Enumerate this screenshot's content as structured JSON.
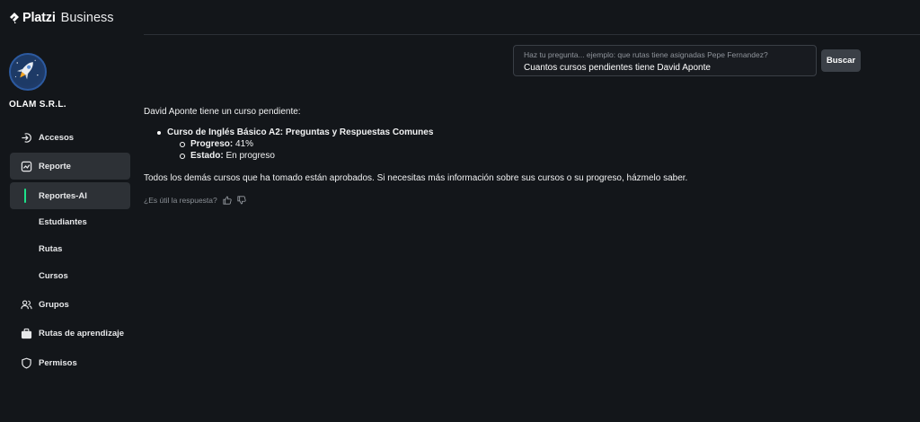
{
  "brand": {
    "name": "Platzi",
    "product": "Business"
  },
  "company": {
    "name": "OLAM S.R.L."
  },
  "sidebar": {
    "items": [
      {
        "label": "Accesos",
        "icon": "login-icon"
      },
      {
        "label": "Reporte",
        "icon": "chart-icon"
      },
      {
        "label": "Reportes-AI"
      },
      {
        "label": "Estudiantes"
      },
      {
        "label": "Rutas"
      },
      {
        "label": "Cursos"
      },
      {
        "label": "Grupos",
        "icon": "users-icon"
      },
      {
        "label": "Rutas de aprendizaje",
        "icon": "briefcase-icon"
      },
      {
        "label": "Permisos",
        "icon": "shield-icon"
      }
    ],
    "active_item": "Reporte",
    "active_subitem": "Reportes-AI",
    "accent_color": "#1ee28a"
  },
  "search": {
    "placeholder": "Haz tu pregunta... ejemplo: que rutas tiene asignadas Pepe Fernandez?",
    "value": "Cuantos cursos pendientes tiene David Aponte",
    "button_label": "Buscar"
  },
  "answer": {
    "intro": "David Aponte tiene un curso pendiente:",
    "course": {
      "name": "Curso de Inglés Básico A2: Preguntas y Respuestas Comunes",
      "progress_label": "Progreso:",
      "progress_value": "41%",
      "status_label": "Estado:",
      "status_value": "En progreso"
    },
    "closing": "Todos los demás cursos que ha tomado están aprobados. Si necesitas más información sobre sus cursos o su progreso, házmelo saber."
  },
  "feedback": {
    "question": "¿Es útil la respuesta?"
  }
}
